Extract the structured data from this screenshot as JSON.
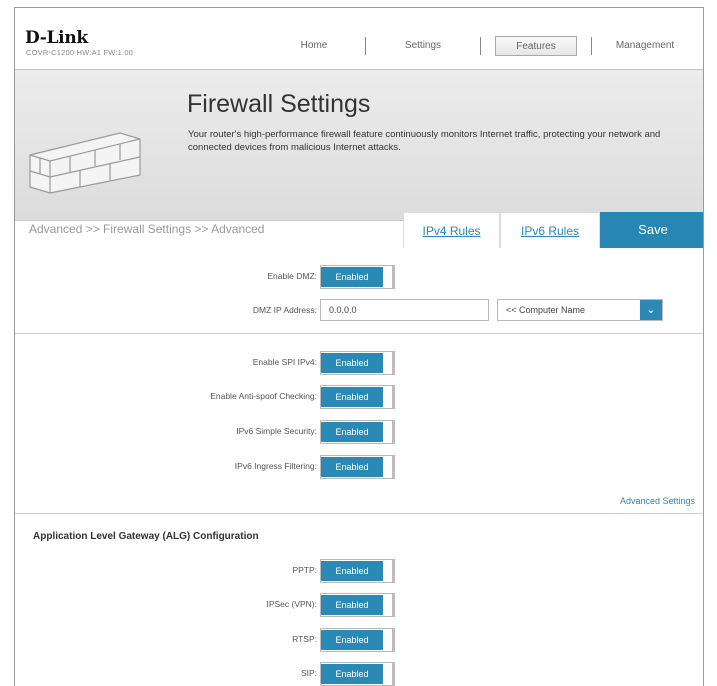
{
  "header": {
    "logo": "D-Link",
    "model": "COVR-C1200 HW:A1 FW:1.00",
    "nav": [
      {
        "label": "Home",
        "active": false
      },
      {
        "label": "Settings",
        "active": false
      },
      {
        "label": "Features",
        "active": true
      },
      {
        "label": "Management",
        "active": false
      }
    ]
  },
  "banner": {
    "title": "Firewall Settings",
    "description": "Your router's high-performance firewall feature continuously monitors Internet traffic, protecting your network and connected devices from malicious Internet attacks."
  },
  "breadcrumb": "Advanced >> Firewall Settings >> Advanced",
  "tabs": {
    "ipv4": "IPv4 Rules",
    "ipv6": "IPv6 Rules",
    "save": "Save"
  },
  "dmz": {
    "enable_label": "Enable DMZ:",
    "enable_value": "Enabled",
    "ip_label": "DMZ IP Address:",
    "ip_value": "0.0.0.0",
    "computer_select": "<< Computer Name"
  },
  "security": {
    "spi_label": "Enable SPI IPv4:",
    "spi_value": "Enabled",
    "antispoof_label": "Enable Anti-spoof Checking:",
    "antispoof_value": "Enabled",
    "ipv6_simple_label": "IPv6 Simple Security:",
    "ipv6_simple_value": "Enabled",
    "ipv6_ingress_label": "IPv6 Ingress Filtering:",
    "ipv6_ingress_value": "Enabled",
    "advanced_link": "Advanced Settings"
  },
  "alg": {
    "title": "Application Level Gateway (ALG) Configuration",
    "pptp_label": "PPTP:",
    "pptp_value": "Enabled",
    "ipsec_label": "IPSec (VPN):",
    "ipsec_value": "Enabled",
    "rtsp_label": "RTSP:",
    "rtsp_value": "Enabled",
    "sip_label": "SIP:",
    "sip_value": "Enabled"
  },
  "colors": {
    "accent": "#2a89b5",
    "save": "#2787b2"
  }
}
